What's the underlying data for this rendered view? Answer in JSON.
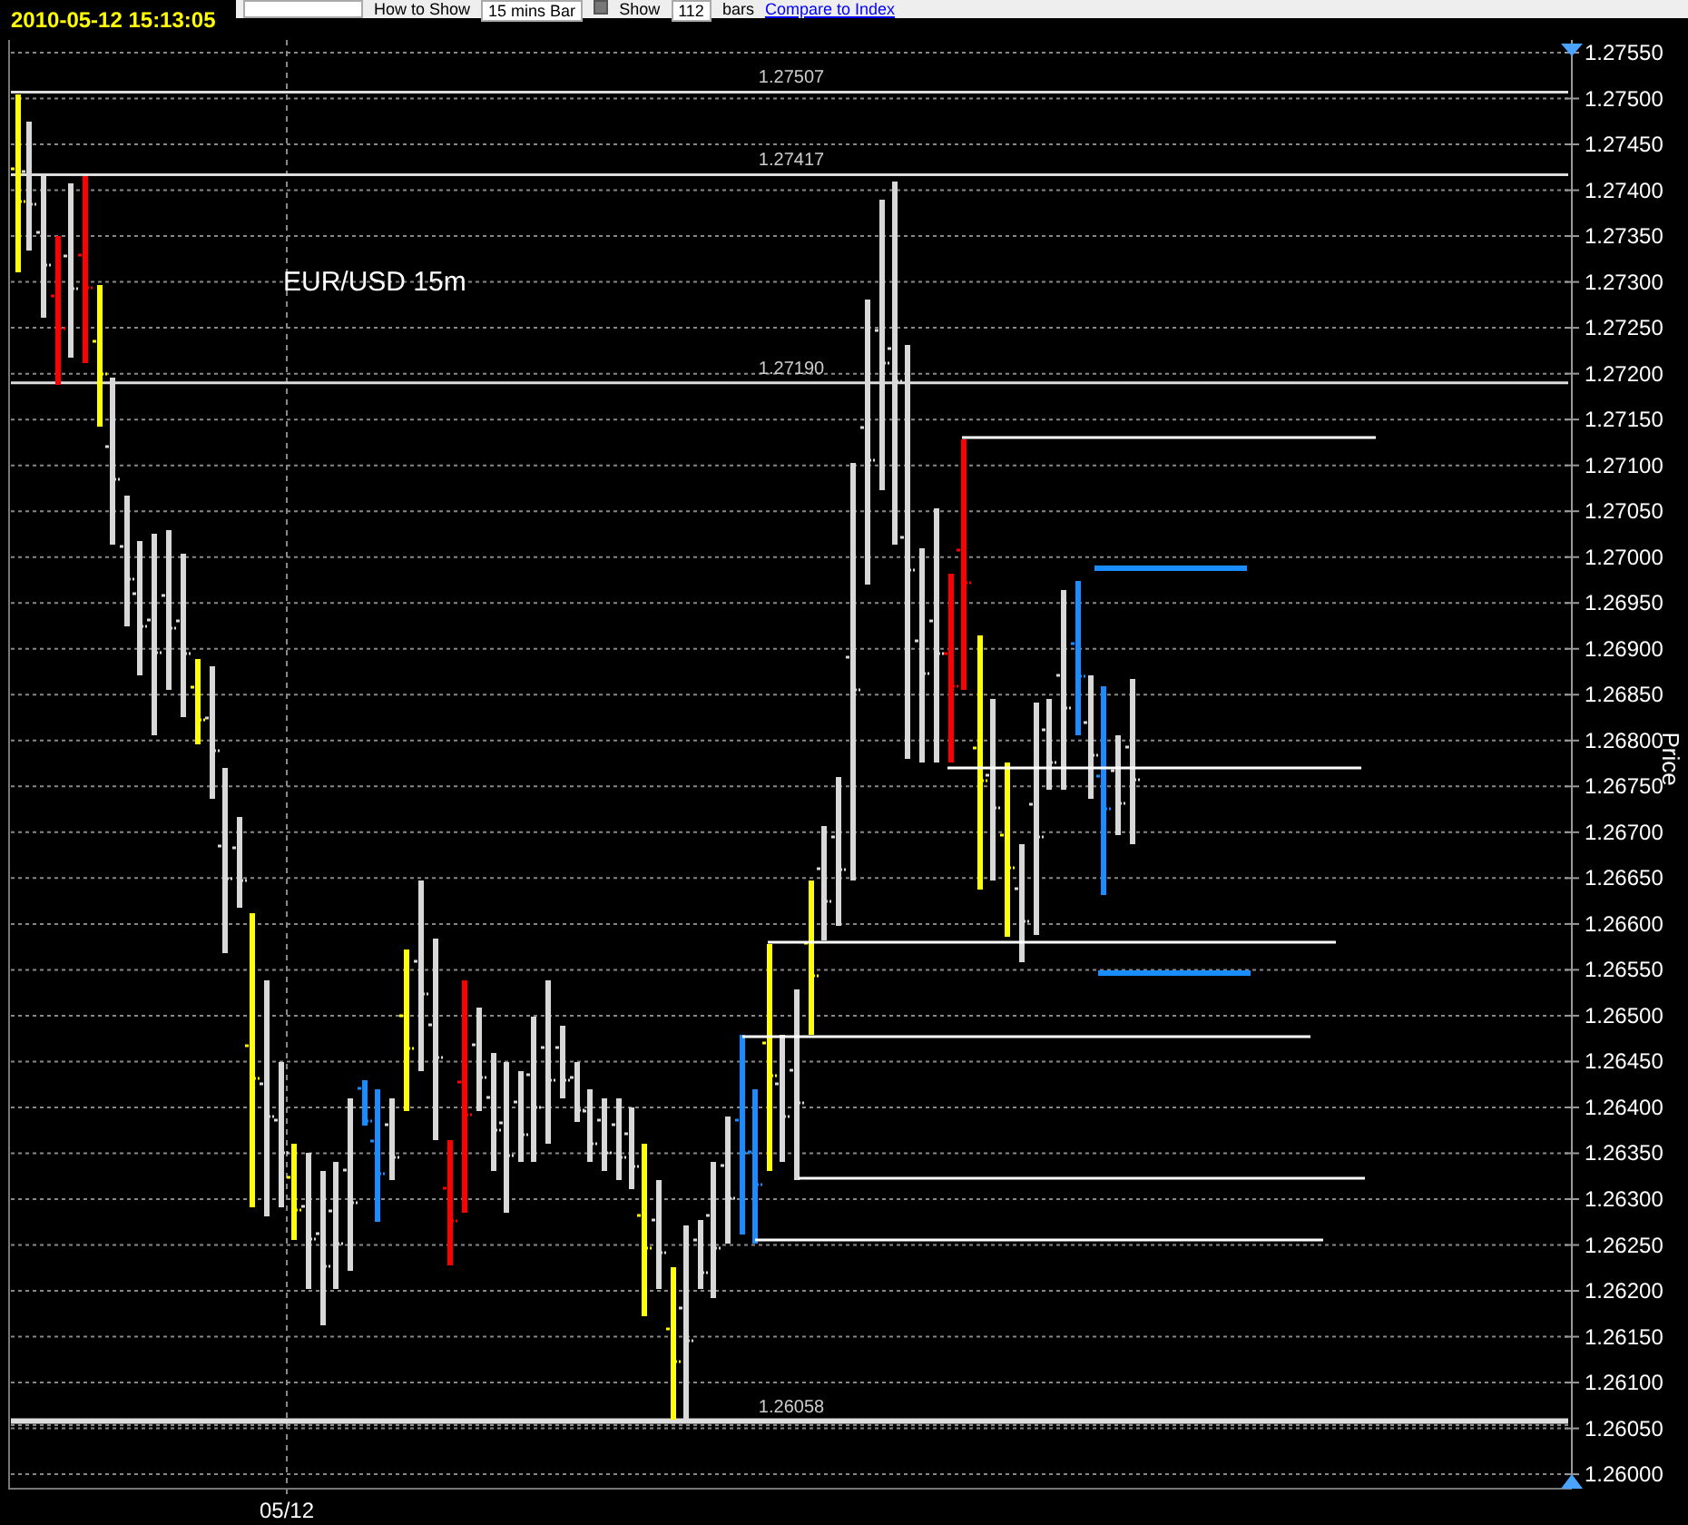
{
  "timestamp": "2010-05-12 15:13:05",
  "toolbar": {
    "show_as_label": "How to Show",
    "bar_type": "15 mins Bar",
    "show_checkbox": {
      "label": "Show",
      "checked": true
    },
    "bar_count": "112",
    "bars_label": "bars",
    "compare_link": "Compare to Index"
  },
  "chart": {
    "title": "EUR/USD 15m",
    "y_axis_label": "Price",
    "y_ticks": [
      "1.27550",
      "1.27500",
      "1.27450",
      "1.27400",
      "1.27350",
      "1.27300",
      "1.27250",
      "1.27200",
      "1.27150",
      "1.27100",
      "1.27050",
      "1.27000",
      "1.26950",
      "1.26900",
      "1.26850",
      "1.26800",
      "1.26750",
      "1.26700",
      "1.26650",
      "1.26600",
      "1.26550",
      "1.26500",
      "1.26450",
      "1.26400",
      "1.26350",
      "1.26300",
      "1.26250",
      "1.26200",
      "1.26150",
      "1.26100",
      "1.26050",
      "1.26000"
    ],
    "x_labels": [
      "05/12"
    ],
    "price_lines": [
      {
        "label": "1.27507"
      },
      {
        "label": "1.27417"
      },
      {
        "label": "1.27190"
      },
      {
        "label": "1.26058"
      }
    ]
  }
}
